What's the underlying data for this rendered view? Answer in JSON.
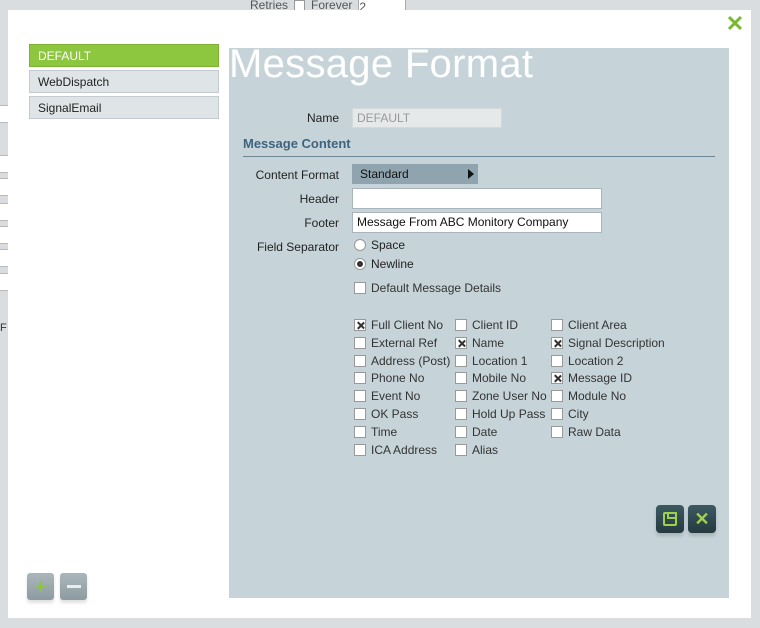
{
  "background": {
    "retries_label": "Retries",
    "forever_label": "Forever",
    "retries_value": "2",
    "side_letter": "F"
  },
  "sidebar": {
    "items": [
      {
        "label": "DEFAULT",
        "active": true
      },
      {
        "label": "WebDispatch",
        "active": false
      },
      {
        "label": "SignalEmail",
        "active": false
      }
    ]
  },
  "panel": {
    "title": "Message Format",
    "name_label": "Name",
    "name_value": "DEFAULT",
    "section_title": "Message Content",
    "content_format_label": "Content Format",
    "content_format_value": "Standard",
    "header_label": "Header",
    "header_value": "",
    "footer_label": "Footer",
    "footer_value": "Message From ABC Monitory Company",
    "field_separator_label": "Field Separator",
    "separator_options": [
      {
        "label": "Space",
        "selected": false
      },
      {
        "label": "Newline",
        "selected": true
      }
    ],
    "default_details_label": "Default Message Details",
    "default_details_checked": false,
    "fields": [
      [
        {
          "label": "Full Client No",
          "checked": true
        },
        {
          "label": "External Ref",
          "checked": false
        },
        {
          "label": "Address (Post)",
          "checked": false
        },
        {
          "label": "Phone No",
          "checked": false
        },
        {
          "label": "Event No",
          "checked": false
        },
        {
          "label": "OK Pass",
          "checked": false
        },
        {
          "label": "Time",
          "checked": false
        },
        {
          "label": "ICA Address",
          "checked": false
        }
      ],
      [
        {
          "label": "Client ID",
          "checked": false
        },
        {
          "label": "Name",
          "checked": true
        },
        {
          "label": "Location 1",
          "checked": false
        },
        {
          "label": "Mobile No",
          "checked": false
        },
        {
          "label": "Zone User No",
          "checked": false
        },
        {
          "label": "Hold Up Pass",
          "checked": false
        },
        {
          "label": "Date",
          "checked": false
        },
        {
          "label": "Alias",
          "checked": false
        }
      ],
      [
        {
          "label": "Client Area",
          "checked": false
        },
        {
          "label": "Signal Description",
          "checked": true
        },
        {
          "label": "Location 2",
          "checked": false
        },
        {
          "label": "Message ID",
          "checked": true
        },
        {
          "label": "Module No",
          "checked": false
        },
        {
          "label": "City",
          "checked": false
        },
        {
          "label": "Raw Data",
          "checked": false
        }
      ]
    ]
  },
  "colors": {
    "accent_green": "#8dc63f",
    "panel_bg": "#c6d4d9",
    "section_title": "#3f6480"
  },
  "icons": {
    "close": "close-icon",
    "save": "save-icon",
    "cancel": "cancel-icon",
    "add": "plus-icon",
    "remove": "minus-icon"
  }
}
